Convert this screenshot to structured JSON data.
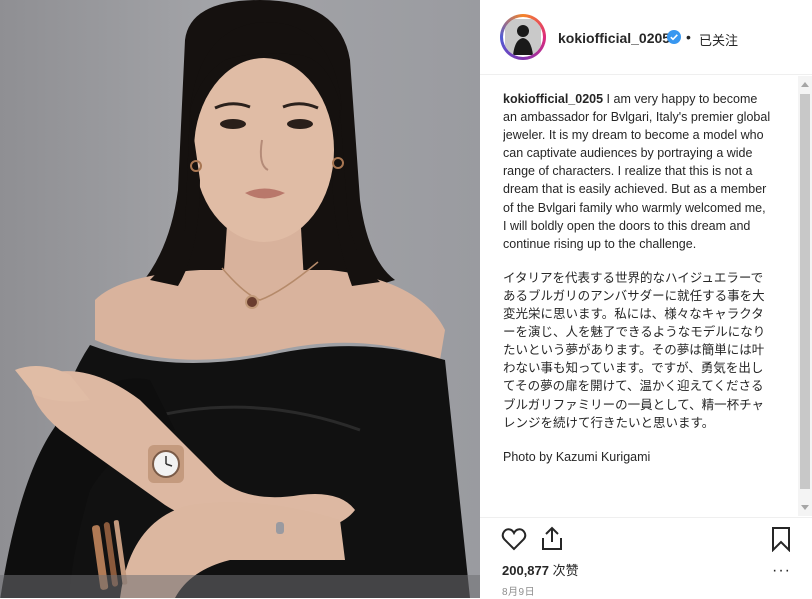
{
  "post": {
    "username": "kokiofficial_0205",
    "follow_label": "已关注",
    "separator": "•",
    "caption_en": "I am very happy to become an ambassador for Bvlgari, Italy's premier global jeweler. It is my dream to become a model who can captivate audiences by portraying a wide range of characters. I realize that this is not a dream that is easily achieved. But as a member of the Bvlgari family who warmly welcomed me, I will boldly open the doors to this dream and continue rising up to the challenge.",
    "caption_jp": "イタリアを代表する世界的なハイジュエラーであるブルガリのアンバサダーに就任する事を大変光栄に思います。私には、様々なキャラクターを演じ、人を魅了できるようなモデルになりたいという夢があります。その夢は簡単には叶わない事も知っています。ですが、勇気を出してその夢の扉を開けて、温かく迎えてくださるブルガリファミリーの一員として、精一杯チャレンジを続けて行きたいと思います。",
    "photo_credit": "Photo by Kazumi Kurigami",
    "likes_count": "200,877",
    "likes_suffix": "次赞",
    "date": "8月9日",
    "more_glyph": "···"
  },
  "icons": {
    "verified": "verified-badge-icon",
    "like": "heart-icon",
    "share": "share-icon",
    "save": "bookmark-icon",
    "more": "more-icon"
  },
  "colors": {
    "verified": "#3897f0",
    "text": "#262626",
    "muted": "#8e8e8e",
    "dress": "#111111",
    "backdrop": "#9a9ba0"
  }
}
